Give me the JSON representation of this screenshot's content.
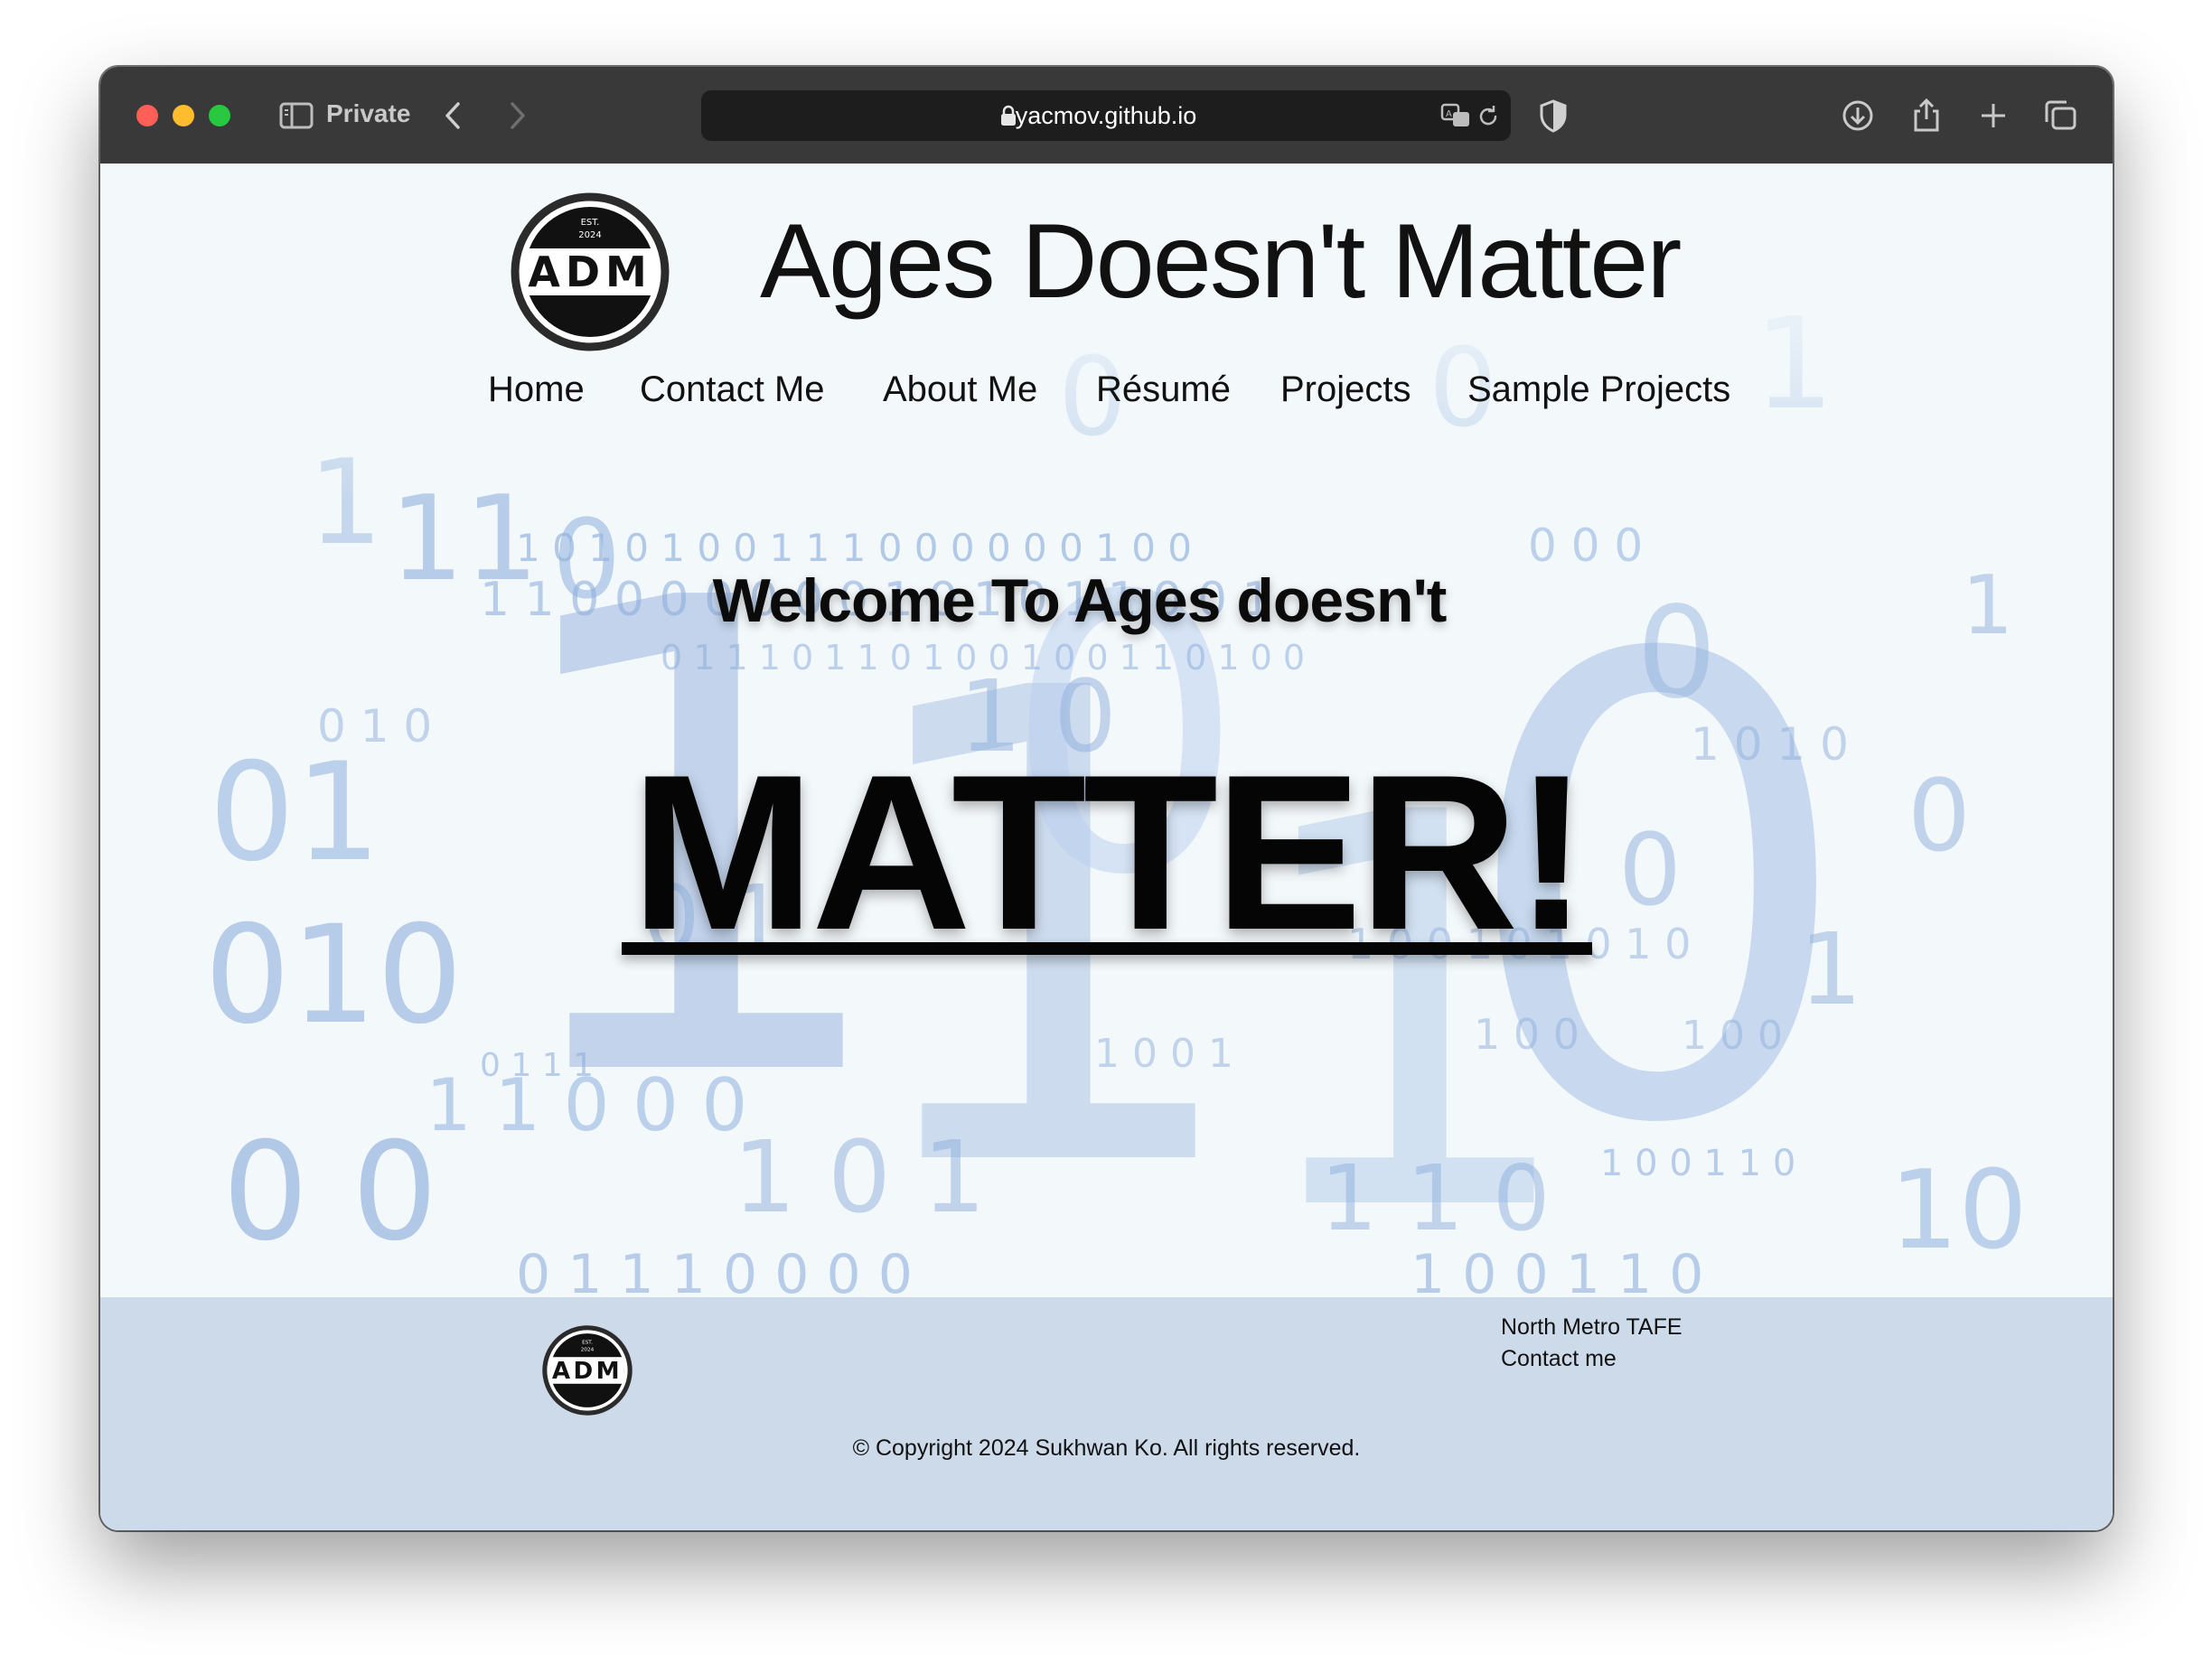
{
  "browser": {
    "private_label": "Private",
    "url": "yacmov.github.io"
  },
  "site": {
    "title": "Ages Doesn't Matter",
    "logo_text": "ADM",
    "logo_est": "EST.",
    "logo_year": "2024"
  },
  "nav": [
    {
      "label": "Home"
    },
    {
      "label": "Contact Me"
    },
    {
      "label": "About Me"
    },
    {
      "label": "Résumé"
    },
    {
      "label": "Projects"
    },
    {
      "label": "Sample Projects"
    }
  ],
  "hero": {
    "welcome": "Welcome To Ages doesn't",
    "headline": "MATTER!"
  },
  "footer": {
    "links": [
      "North Metro TAFE",
      "Contact me"
    ],
    "copyright": "© Copyright 2024 Sukhwan Ko. All rights reserved."
  },
  "colors": {
    "toolbar": "#393939",
    "page_bg": "#f3f8fb",
    "footer_bg": "#ccdae9",
    "binary_digits": "#8fb0dd"
  }
}
